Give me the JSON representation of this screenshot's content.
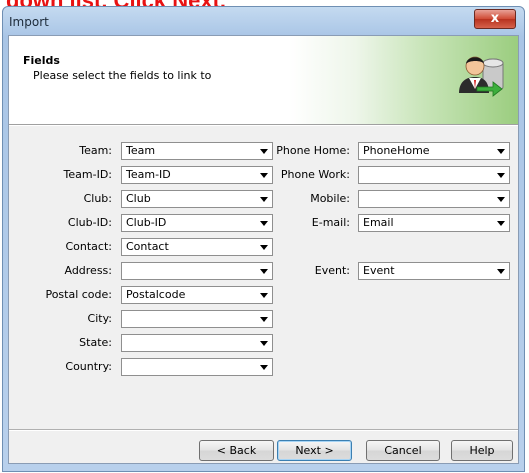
{
  "caption": "down list. Click Next.",
  "window": {
    "title": "Import",
    "close_glyph": "x"
  },
  "header": {
    "title": "Fields",
    "subtitle": "Please select the fields to link to",
    "icon": "user-database-icon"
  },
  "left_fields": [
    {
      "label": "Team:",
      "value": "Team"
    },
    {
      "label": "Team-ID:",
      "value": "Team-ID"
    },
    {
      "label": "Club:",
      "value": "Club"
    },
    {
      "label": "Club-ID:",
      "value": "Club-ID"
    },
    {
      "label": "Contact:",
      "value": "Contact"
    },
    {
      "label": "Address:",
      "value": ""
    },
    {
      "label": "Postal code:",
      "value": "Postalcode"
    },
    {
      "label": "City:",
      "value": ""
    },
    {
      "label": "State:",
      "value": ""
    },
    {
      "label": "Country:",
      "value": ""
    }
  ],
  "right_fields": [
    {
      "label": "Phone Home:",
      "value": "PhoneHome"
    },
    {
      "label": "Phone Work:",
      "value": ""
    },
    {
      "label": "Mobile:",
      "value": ""
    },
    {
      "label": "E-mail:",
      "value": "Email"
    },
    {
      "label": "Event:",
      "value": "Event"
    }
  ],
  "buttons": {
    "back": "< Back",
    "next": "Next >",
    "cancel": "Cancel",
    "help": "Help"
  }
}
